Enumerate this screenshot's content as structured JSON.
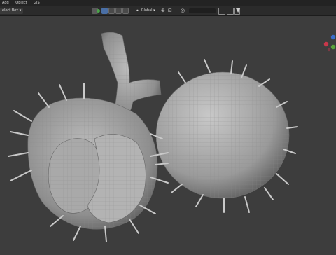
{
  "menu": {
    "items": [
      "Add",
      "Object",
      "GIS"
    ]
  },
  "toolbar": {
    "select_mode": "elect Box",
    "orientation": "Global"
  },
  "icons": {
    "select_mode": "select-box-icon",
    "orientation": "transform-orientation-icon",
    "pivot": "pivot-point-icon",
    "snap": "snap-icon",
    "proportional": "proportional-edit-icon",
    "filter": "filter-icon",
    "viewport_display": "viewport-display-icon",
    "gizmo": "navigation-gizmo-icon"
  },
  "colors": {
    "gizmo_x": "#c9374a",
    "gizmo_y": "#5aa13b",
    "gizmo_z": "#3b6cc9"
  }
}
